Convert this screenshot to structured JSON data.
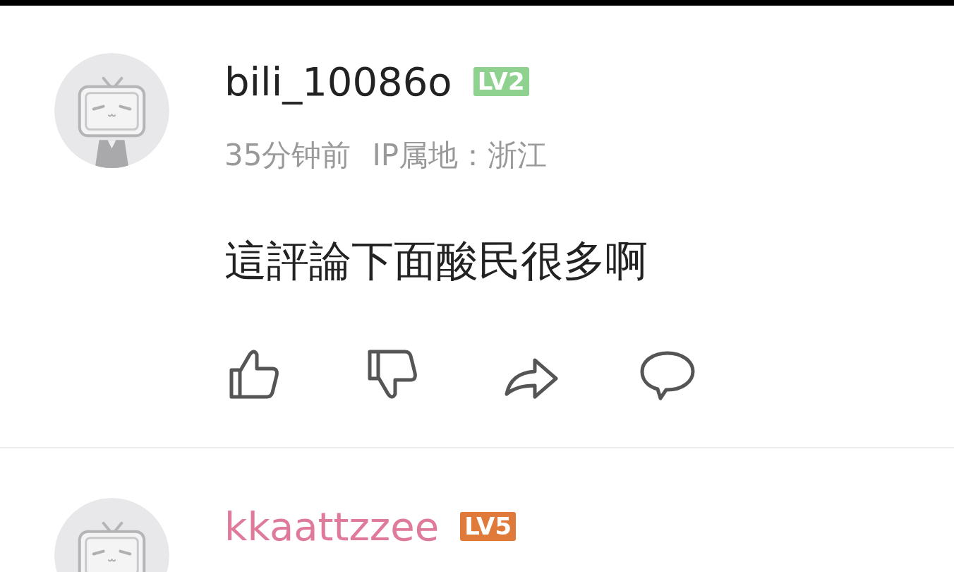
{
  "comments": [
    {
      "username": "bili_10086o",
      "vip": false,
      "level": "LV2",
      "color": "#8fd18f",
      "time": "35分钟前",
      "ip": "IP属地：浙江",
      "text": "這評論下面酸民很多啊"
    },
    {
      "username": "kkaattzzee",
      "vip": true,
      "level": "LV5",
      "color": "#e07a3a"
    }
  ]
}
